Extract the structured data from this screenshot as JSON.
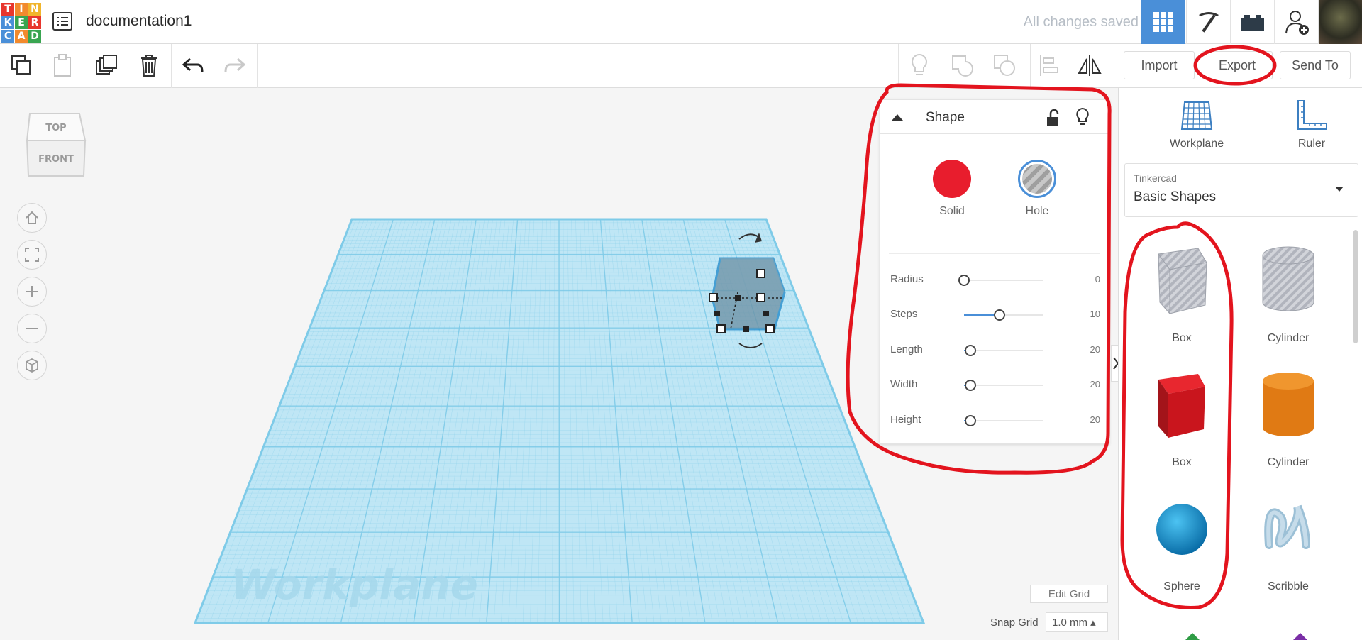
{
  "logo": {
    "letters": [
      "T",
      "I",
      "N",
      "K",
      "E",
      "R",
      "C",
      "A",
      "D"
    ]
  },
  "header": {
    "doc_title": "documentation1",
    "save_status": "All changes saved",
    "buttons": [
      {
        "name": "3d-view",
        "icon": "grid-icon",
        "active": true
      },
      {
        "name": "blocks",
        "icon": "pickaxe-icon"
      },
      {
        "name": "bricks",
        "icon": "bricks-icon"
      },
      {
        "name": "invite",
        "icon": "add-user-icon"
      }
    ]
  },
  "toolbar": {
    "import_label": "Import",
    "export_label": "Export",
    "send_label": "Send To"
  },
  "viewcube": {
    "top": "TOP",
    "front": "FRONT"
  },
  "workplane": {
    "watermark": "Workplane",
    "edit_grid": "Edit Grid",
    "snap_label": "Snap Grid",
    "snap_value": "1.0 mm ▴"
  },
  "inspector": {
    "title": "Shape",
    "solid_label": "Solid",
    "hole_label": "Hole",
    "solid_color": "#e81d2d",
    "props": [
      {
        "label": "Radius",
        "value": "0",
        "fraction": 0.0
      },
      {
        "label": "Steps",
        "value": "10",
        "fraction": 0.45
      },
      {
        "label": "Length",
        "value": "20",
        "fraction": 0.08
      },
      {
        "label": "Width",
        "value": "20",
        "fraction": 0.08
      },
      {
        "label": "Height",
        "value": "20",
        "fraction": 0.08
      }
    ]
  },
  "right_panel": {
    "workplane_label": "Workplane",
    "ruler_label": "Ruler",
    "library_small": "Tinkercad",
    "library_big": "Basic Shapes",
    "shapes": [
      {
        "label": "Box",
        "kind": "box-hole"
      },
      {
        "label": "Cylinder",
        "kind": "cylinder-hole"
      },
      {
        "label": "Box",
        "kind": "box-red"
      },
      {
        "label": "Cylinder",
        "kind": "cylinder-orange"
      },
      {
        "label": "Sphere",
        "kind": "sphere-blue"
      },
      {
        "label": "Scribble",
        "kind": "scribble"
      }
    ]
  },
  "colors": {
    "accent": "#4a8fd8",
    "annotation": "#e3141e",
    "grid": "#7fcbe8"
  }
}
